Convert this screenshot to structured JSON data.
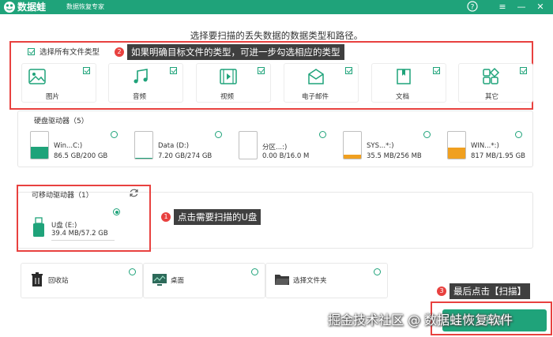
{
  "app": {
    "name": "数据蛙",
    "subtitle": "数据恢复专家",
    "controls": [
      "?",
      "≡",
      "—",
      "✕"
    ]
  },
  "instruction": "选择要扫描的丢失数据的数据类型和路径。",
  "file_types": {
    "select_all_label": "选择所有文件类型",
    "select_all_checked": true,
    "items": [
      {
        "label": "图片",
        "icon": "image-icon",
        "checked": true
      },
      {
        "label": "音频",
        "icon": "music-icon",
        "checked": true
      },
      {
        "label": "视频",
        "icon": "video-icon",
        "checked": true
      },
      {
        "label": "电子邮件",
        "icon": "email-icon",
        "checked": true
      },
      {
        "label": "文档",
        "icon": "document-icon",
        "checked": true
      },
      {
        "label": "其它",
        "icon": "other-icon",
        "checked": true
      }
    ]
  },
  "tips": [
    {
      "num": "2",
      "text": "如果明确目标文件的类型，可进一步勾选相应的类型"
    },
    {
      "num": "1",
      "text": "点击需要扫描的U盘"
    },
    {
      "num": "3",
      "text": "最后点击【扫描】"
    }
  ],
  "hard_disk": {
    "title": "硬盘驱动器（5）",
    "drives": [
      {
        "name": "Win...C:)",
        "size": "86.5 GB/200 GB",
        "fill_percent": 43,
        "color": "#1fa37a"
      },
      {
        "name": "Data (D:)",
        "size": "7.20 GB/274 GB",
        "fill_percent": 3,
        "color": "#1fa37a"
      },
      {
        "name": "分区...:)",
        "size": "0.00  B/16.0 M",
        "fill_percent": 0,
        "color": "#f0a020"
      },
      {
        "name": "SYS...*:)",
        "size": "35.5 MB/256 MB",
        "fill_percent": 14,
        "color": "#f0a020"
      },
      {
        "name": "WIN...*:)",
        "size": "817 MB/1.95 GB",
        "fill_percent": 42,
        "color": "#f0a020"
      }
    ]
  },
  "removable": {
    "title": "可移动驱动器（1）",
    "drive": {
      "name": "U盘 (E:)",
      "size": "39.4 MB/57.2 GB",
      "selected": true
    }
  },
  "locations": [
    {
      "label": "回收站",
      "icon": "recycle-bin-icon"
    },
    {
      "label": "桌面",
      "icon": "desktop-icon"
    },
    {
      "label": "选择文件夹",
      "icon": "folder-icon"
    }
  ],
  "scan_button": "扫描",
  "watermark": "掘金技术社区 @ 数据蛙恢复软件",
  "colors": {
    "accent": "#1fa37a",
    "annotation_red": "#e8413f",
    "warning": "#f0a020"
  }
}
